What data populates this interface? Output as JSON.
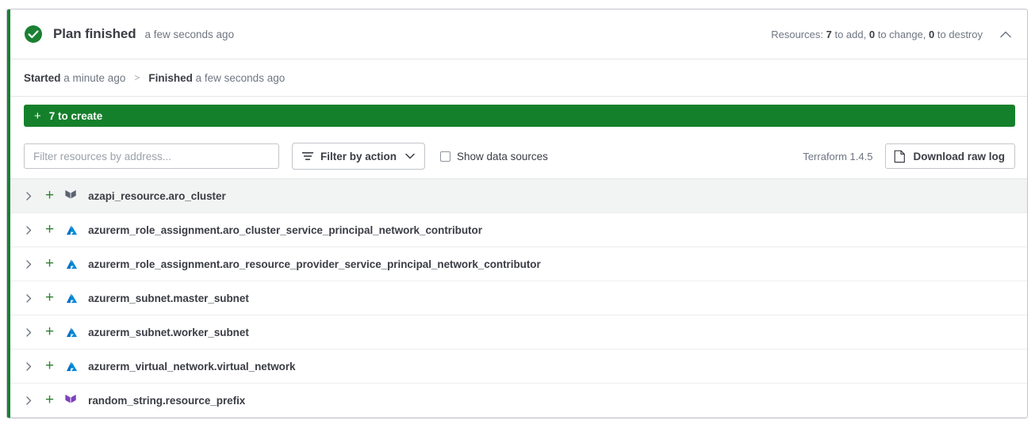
{
  "card": {
    "status_color": "#1a7f37",
    "status_icon": "check-circle-icon",
    "title": "Plan finished",
    "time_ago": "a few seconds ago",
    "resources_summary": {
      "prefix": "Resources:",
      "add_count": "7",
      "add_label": "to add,",
      "change_count": "0",
      "change_label": "to change,",
      "destroy_count": "0",
      "destroy_label": "to destroy"
    },
    "collapse_icon": "chevron-up-icon"
  },
  "breadcrumb": {
    "started_label": "Started",
    "started_time": "a minute ago",
    "separator": ">",
    "finished_label": "Finished",
    "finished_time": "a few seconds ago"
  },
  "banner": {
    "plus": "+",
    "label": "7 to create",
    "color": "#15802b"
  },
  "toolbar": {
    "filter_placeholder": "Filter resources by address...",
    "filter_value": "",
    "action_dropdown_label": "Filter by action",
    "action_dropdown_icon": "filter-icon",
    "action_dropdown_chevron": "chevron-down-icon",
    "show_data_sources_label": "Show data sources",
    "show_data_sources_checked": false,
    "terraform_version": "Terraform 1.4.5",
    "download_label": "Download raw log",
    "download_icon": "document-icon"
  },
  "resources": [
    {
      "address": "azapi_resource.aro_cluster",
      "action": "create",
      "action_symbol": "+",
      "provider_icon": "terraform-logo-icon",
      "provider_color": "#5c6370",
      "shaded": true
    },
    {
      "address": "azurerm_role_assignment.aro_cluster_service_principal_network_contributor",
      "action": "create",
      "action_symbol": "+",
      "provider_icon": "azure-logo-icon",
      "provider_color": "#0089d6",
      "shaded": false
    },
    {
      "address": "azurerm_role_assignment.aro_resource_provider_service_principal_network_contributor",
      "action": "create",
      "action_symbol": "+",
      "provider_icon": "azure-logo-icon",
      "provider_color": "#0089d6",
      "shaded": false
    },
    {
      "address": "azurerm_subnet.master_subnet",
      "action": "create",
      "action_symbol": "+",
      "provider_icon": "azure-logo-icon",
      "provider_color": "#0089d6",
      "shaded": false
    },
    {
      "address": "azurerm_subnet.worker_subnet",
      "action": "create",
      "action_symbol": "+",
      "provider_icon": "azure-logo-icon",
      "provider_color": "#0089d6",
      "shaded": false
    },
    {
      "address": "azurerm_virtual_network.virtual_network",
      "action": "create",
      "action_symbol": "+",
      "provider_icon": "azure-logo-icon",
      "provider_color": "#0089d6",
      "shaded": false
    },
    {
      "address": "random_string.resource_prefix",
      "action": "create",
      "action_symbol": "+",
      "provider_icon": "terraform-logo-icon",
      "provider_color": "#7b42bc",
      "shaded": false
    }
  ]
}
